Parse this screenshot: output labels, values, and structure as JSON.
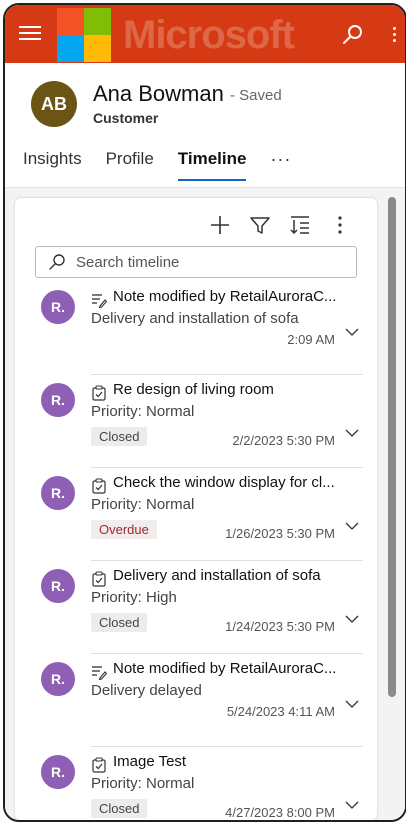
{
  "topbar": {
    "brand": "Microsoft",
    "colors": {
      "bar": "#d63a14",
      "logo_red": "#f35325",
      "logo_green": "#81bc06",
      "logo_blue": "#05a6f0",
      "logo_yellow": "#ffba08"
    }
  },
  "record": {
    "initials": "AB",
    "name": "Ana Bowman",
    "status": "- Saved",
    "type": "Customer"
  },
  "tabs": [
    {
      "label": "Insights"
    },
    {
      "label": "Profile"
    },
    {
      "label": "Timeline"
    }
  ],
  "tab_more": "···",
  "search": {
    "placeholder": "Search timeline"
  },
  "timeline": [
    {
      "avatar": "R.",
      "icon": "note-icon",
      "title": "Note modified by RetailAuroraC...",
      "subtitle": "Delivery and installation of sofa",
      "badge": "",
      "time": "2:09 AM"
    },
    {
      "avatar": "R.",
      "icon": "task-icon",
      "title": "Re design of living room",
      "subtitle": "Priority: Normal",
      "badge": "Closed",
      "time": "2/2/2023 5:30 PM"
    },
    {
      "avatar": "R.",
      "icon": "task-icon",
      "title": "Check the window display for cl...",
      "subtitle": "Priority: Normal",
      "badge": "Overdue",
      "time": "1/26/2023 5:30 PM"
    },
    {
      "avatar": "R.",
      "icon": "task-icon",
      "title": "Delivery and installation of sofa",
      "subtitle": "Priority: High",
      "badge": "Closed",
      "time": "1/24/2023 5:30 PM"
    },
    {
      "avatar": "R.",
      "icon": "note-icon",
      "title": "Note modified by RetailAuroraC...",
      "subtitle": "Delivery delayed",
      "badge": "",
      "time": "5/24/2023 4:11 AM"
    },
    {
      "avatar": "R.",
      "icon": "task-icon",
      "title": "Image Test",
      "subtitle": "Priority: Normal",
      "badge": "Closed",
      "time": "4/27/2023 8:00 PM"
    }
  ]
}
